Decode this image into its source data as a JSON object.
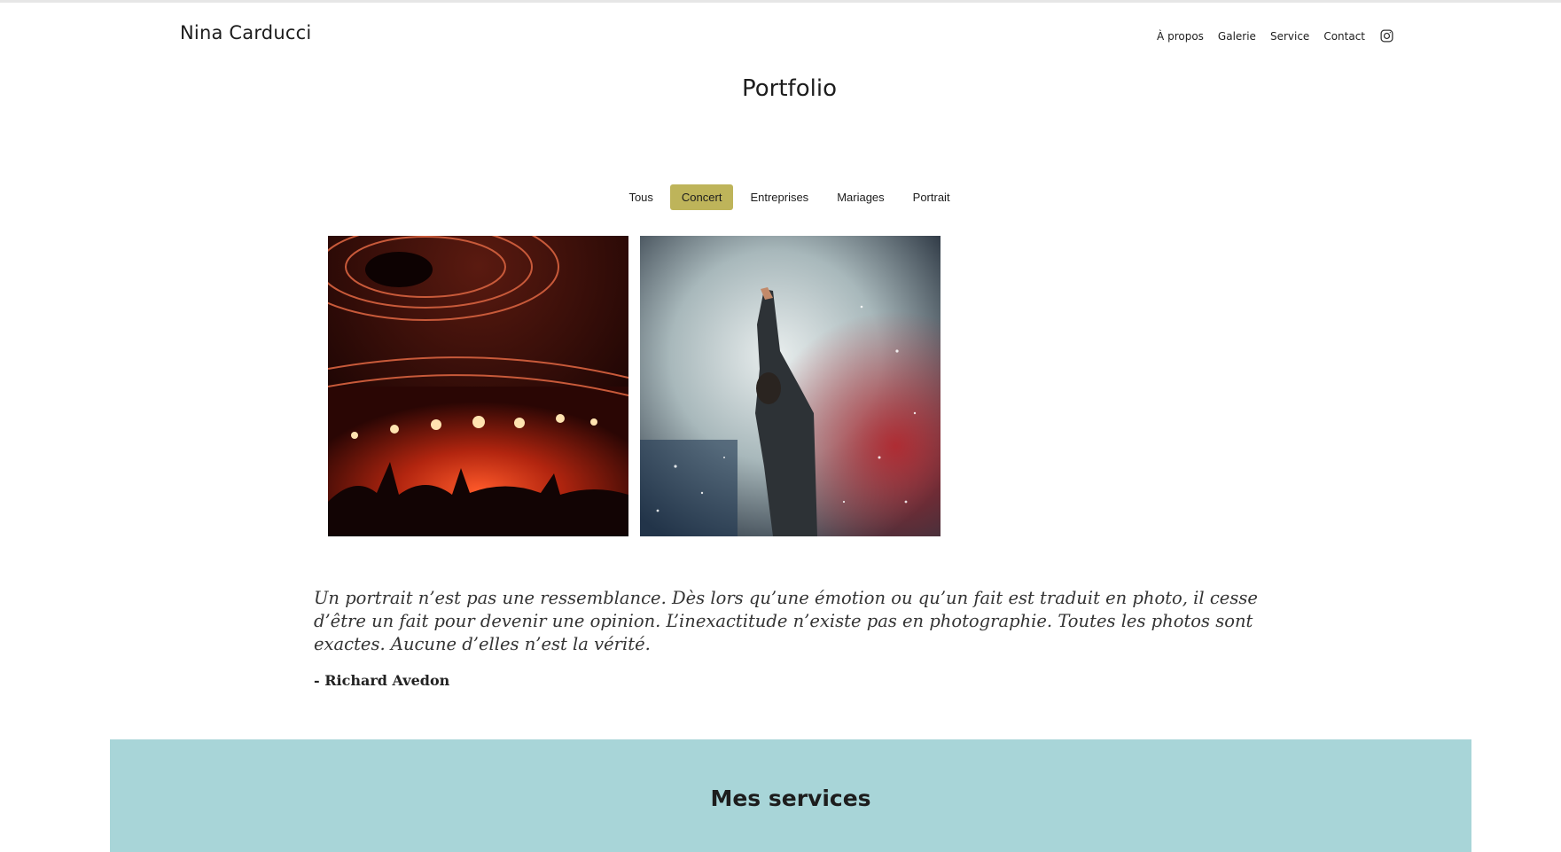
{
  "brand": "Nina Carducci",
  "nav": {
    "items": [
      {
        "label": "À propos"
      },
      {
        "label": "Galerie"
      },
      {
        "label": "Service"
      },
      {
        "label": "Contact"
      }
    ],
    "instagram_icon": "instagram-icon"
  },
  "portfolio": {
    "title": "Portfolio",
    "filters": [
      {
        "label": "Tous",
        "active": false
      },
      {
        "label": "Concert",
        "active": true
      },
      {
        "label": "Entreprises",
        "active": false
      },
      {
        "label": "Mariages",
        "active": false
      },
      {
        "label": "Portrait",
        "active": false
      }
    ],
    "active_color": "#BEB45A"
  },
  "quote": {
    "text": "Un portrait n’est pas une ressemblance. Dès lors qu’une émotion ou qu’un fait est traduit en photo, il cesse d’être un fait pour devenir une opinion. L’inexactitude n’existe pas en photographie. Toutes les photos sont exactes. Aucune d’elles n’est la vérité.",
    "author": "- Richard Avedon"
  },
  "services": {
    "title": "Mes services",
    "background": "#A8D5D8"
  }
}
